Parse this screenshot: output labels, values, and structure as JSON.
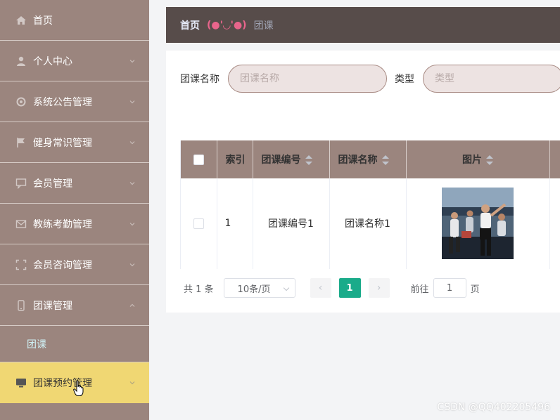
{
  "sidebar": {
    "items": [
      {
        "label": "首页",
        "icon": "home-icon"
      },
      {
        "label": "个人中心",
        "icon": "user-icon"
      },
      {
        "label": "系统公告管理",
        "icon": "gear-icon"
      },
      {
        "label": "健身常识管理",
        "icon": "flag-icon"
      },
      {
        "label": "会员管理",
        "icon": "chat-icon"
      },
      {
        "label": "教练考勤管理",
        "icon": "mail-icon"
      },
      {
        "label": "会员咨询管理",
        "icon": "frame-icon"
      },
      {
        "label": "团课管理",
        "icon": "phone-icon"
      }
    ],
    "submenu": {
      "label": "团课"
    },
    "active_item": {
      "label": "团课预约管理",
      "icon": "monitor-icon"
    }
  },
  "breadcrumb": {
    "home": "首页",
    "separator": "(●'◡'●)",
    "current": "团课"
  },
  "search": {
    "name_label": "团课名称",
    "name_placeholder": "团课名称",
    "type_label": "类型",
    "type_placeholder": "类型"
  },
  "table": {
    "headers": {
      "index": "索引",
      "code": "团课编号",
      "name": "团课名称",
      "image": "图片"
    },
    "rows": [
      {
        "index": "1",
        "code": "团课编号1",
        "name": "团课名称1"
      }
    ]
  },
  "pagination": {
    "total": "共 1 条",
    "page_size": "10条/页",
    "prev": "‹",
    "current_page": "1",
    "next": "›",
    "goto_label": "前往",
    "goto_value": "1",
    "page_suffix": "页"
  },
  "watermark": "CSDN @QQ402205496",
  "colors": {
    "sidebar": "#9b857e",
    "active": "#f0d773",
    "breadcrumb_bar": "#574c4a",
    "accent": "#1aab8a"
  }
}
